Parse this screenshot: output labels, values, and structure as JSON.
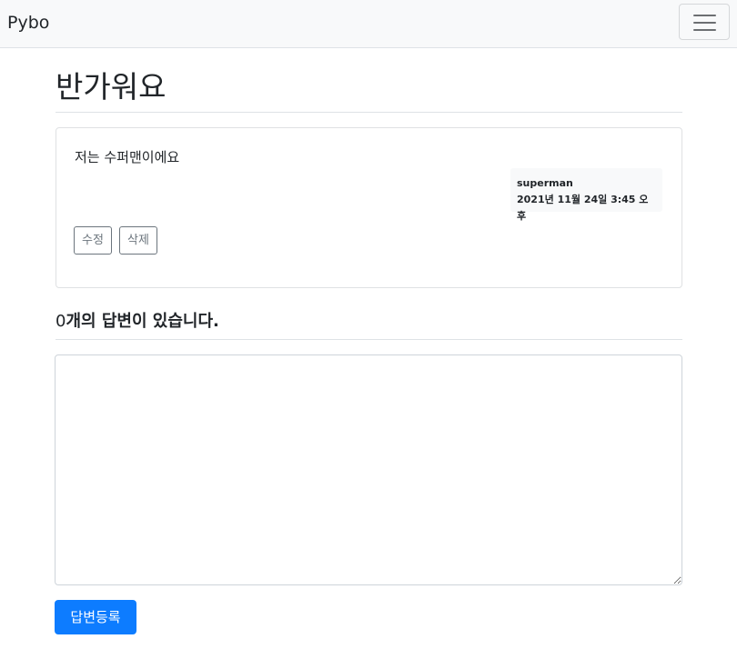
{
  "navbar": {
    "brand": "Pybo",
    "menu_icon": "hamburger-menu-icon"
  },
  "question": {
    "subject": "반가워요",
    "content": "저는 수퍼맨이에요",
    "author": "superman",
    "create_date": "2021년 11월 24일 3:45 오후",
    "modify_label": "수정",
    "delete_label": "삭제"
  },
  "answers": {
    "count": "0",
    "count_suffix": "개의 답변이 있습니다."
  },
  "answer_form": {
    "content": "",
    "submit_label": "답변등록"
  },
  "colors": {
    "primary": "#0d7cff",
    "secondary": "#6c757d",
    "navbar_bg": "#f8f9fa"
  }
}
